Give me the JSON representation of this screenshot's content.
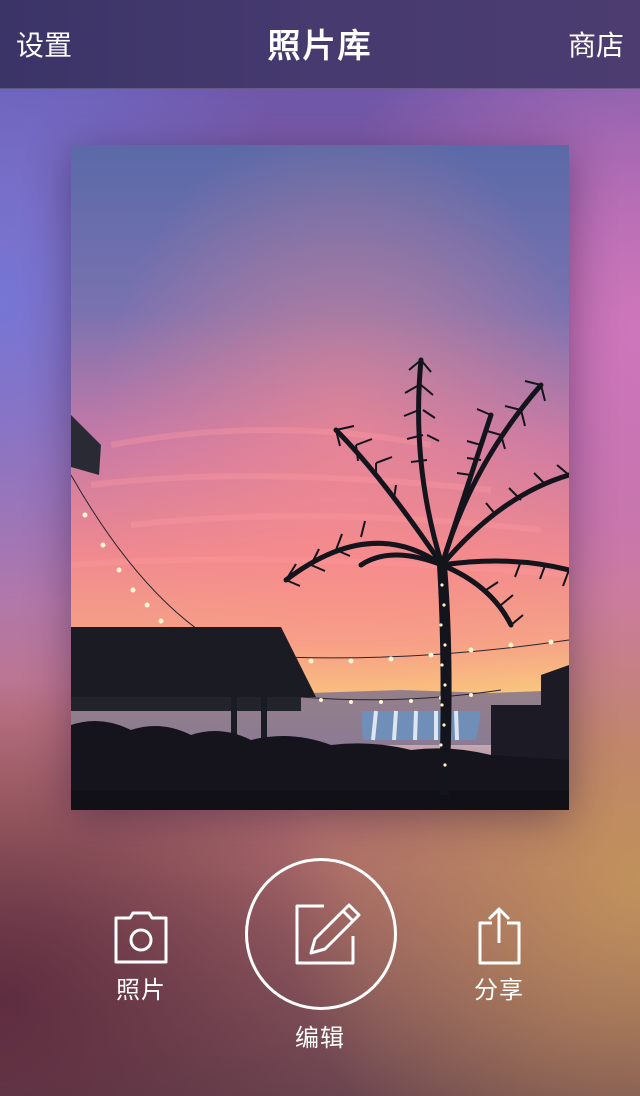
{
  "nav": {
    "left_label": "设置",
    "title": "照片库",
    "right_label": "商店"
  },
  "photo": {
    "icon": "sunset-palm-photo"
  },
  "toolbar": {
    "photo_label": "照片",
    "photo_icon": "camera-icon",
    "edit_label": "编辑",
    "edit_icon": "edit-pencil-icon",
    "share_label": "分享",
    "share_icon": "share-icon"
  },
  "colors": {
    "topbar": "#3b3467",
    "sky_top": "#5b6aa6",
    "sky_glow": "#f08a88",
    "horizon": "#f6c07a",
    "silhouette": "#12121a"
  }
}
